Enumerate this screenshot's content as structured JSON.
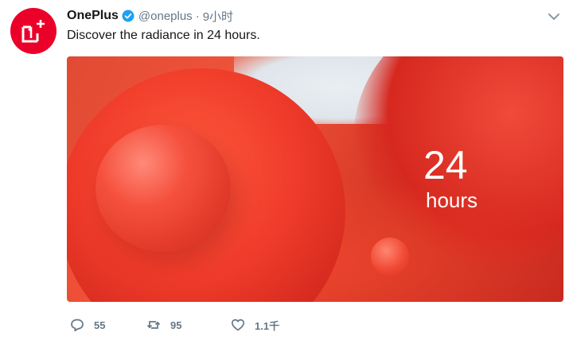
{
  "tweet": {
    "author_name": "OnePlus",
    "handle": "@oneplus",
    "separator": "·",
    "time": "9小时",
    "text": "Discover the radiance in 24 hours.",
    "media": {
      "number": "24",
      "unit": "hours"
    },
    "actions": {
      "reply_count": "55",
      "retweet_count": "95",
      "like_count": "1.1千"
    }
  },
  "colors": {
    "brand_red": "#eb0029",
    "verified_blue": "#1da1f2",
    "muted_text": "#657786"
  },
  "icons": [
    "oneplus-logo-icon",
    "verified-badge-icon",
    "chevron-down-icon",
    "reply-icon",
    "retweet-icon",
    "like-icon"
  ]
}
